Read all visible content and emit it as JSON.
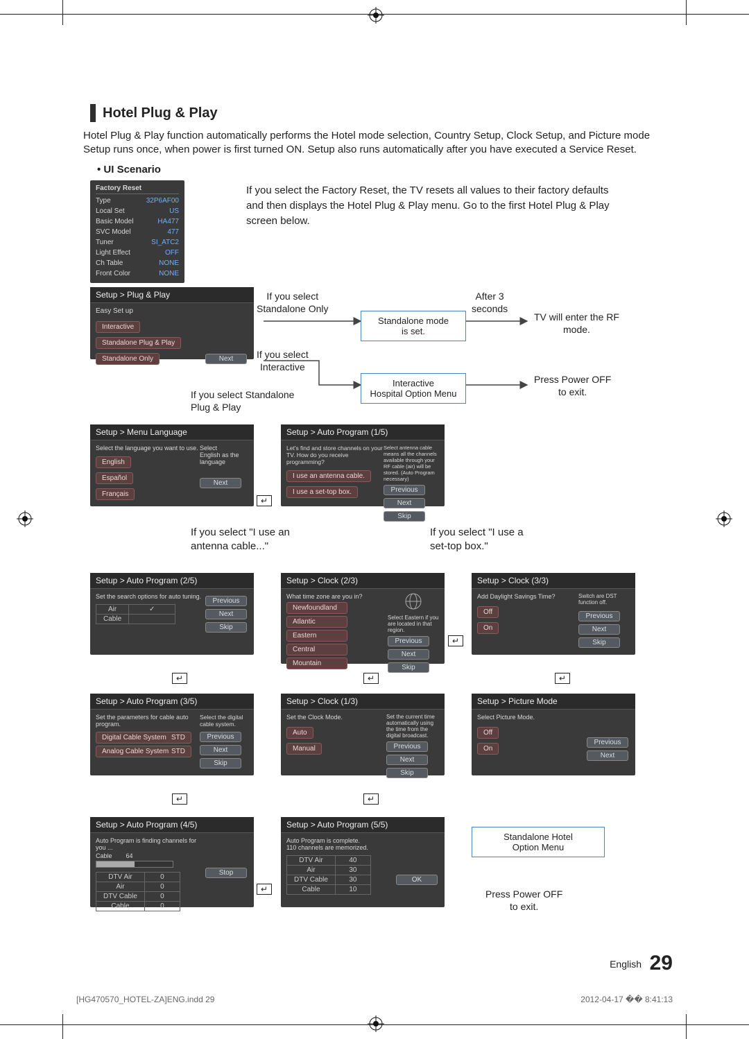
{
  "section_title": "Hotel Plug & Play",
  "intro": "Hotel Plug & Play function automatically performs the Hotel mode selection, Country Setup, Clock Setup, and Picture mode Setup runs once, when power is first turned ON. Setup also runs automatically after you have executed a Service Reset.",
  "bullet_ui": "UI Scenario",
  "factory_reset": {
    "title": "Factory Reset",
    "rows": [
      {
        "k": "Type",
        "v": "32P6AF00"
      },
      {
        "k": "Local Set",
        "v": "US"
      },
      {
        "k": "Basic Model",
        "v": "HA477"
      },
      {
        "k": "SVC Model",
        "v": "477"
      },
      {
        "k": "Tuner",
        "v": "SI_ATC2"
      },
      {
        "k": "Light Effect",
        "v": "OFF"
      },
      {
        "k": "Ch Table",
        "v": "NONE"
      },
      {
        "k": "Front Color",
        "v": "NONE"
      }
    ]
  },
  "text_top": "If you select the Factory Reset, the TV resets all values to their factory defaults and then displays the Hotel Plug & Play menu. Go to the first Hotel Plug & Play screen below.",
  "plug_play": {
    "hdr": "Setup > Plug & Play",
    "easy": "Easy Set up",
    "opts": [
      "Interactive",
      "Standalone Plug & Play",
      "Standalone Only"
    ],
    "next": "Next"
  },
  "lbl_standalone_only": "If you select\nStandalone Only",
  "lbl_interactive": "If you select\nInteractive",
  "lbl_standalone_pp": "If you select Standalone\nPlug & Play",
  "box_standalone_mode": "Standalone mode\nis set.",
  "lbl_after3": "After 3\nseconds",
  "lbl_rfmode": "TV will enter the RF\nmode.",
  "box_interactive_menu": "Interactive\nHospital Option Menu",
  "lbl_press_off": "Press Power OFF\nto exit.",
  "menu_lang": {
    "hdr": "Setup > Menu Language",
    "prompt": "Select the language you want to use.",
    "note": "Select\nEnglish as the\nlanguage",
    "opts": [
      "English",
      "Español",
      "Français"
    ],
    "next": "Next"
  },
  "auto1": {
    "hdr": "Setup > Auto Program (1/5)",
    "prompt": "Let's find and store channels on your TV. How do you receive programming?",
    "note": "Select antenna cable means all the channels available through your RF cable (air) will be stored. (Auto Program necessary)",
    "opt1": "I use an antenna cable.",
    "opt2": "I use a set-top box.",
    "prev": "Previous",
    "next": "Next",
    "skip": "Skip"
  },
  "lbl_antenna": "If you select \"I use an\nantenna cable...\"",
  "lbl_settop": "If you select \"I use a\nset-top box.\"",
  "auto2": {
    "hdr": "Setup > Auto Program (2/5)",
    "prompt": "Set the search options for auto tuning.",
    "rows": [
      {
        "a": "Air",
        "b": "✓"
      },
      {
        "a": "Cable",
        "b": ""
      }
    ],
    "prev": "Previous",
    "next": "Next",
    "skip": "Skip"
  },
  "clock2": {
    "hdr": "Setup > Clock (2/3)",
    "prompt": "What time zone are you in?",
    "note": "Select Eastern if you are located in that region.",
    "opts": [
      "Newfoundland",
      "Atlantic",
      "Eastern",
      "Central",
      "Mountain"
    ],
    "prev": "Previous",
    "next": "Next",
    "skip": "Skip"
  },
  "clock3": {
    "hdr": "Setup > Clock (3/3)",
    "prompt": "Add Daylight Savings Time?",
    "note": "Switch are DST function off.",
    "opts": [
      "Off",
      "On"
    ],
    "prev": "Previous",
    "next": "Next",
    "skip": "Skip"
  },
  "auto3": {
    "hdr": "Setup > Auto Program (3/5)",
    "prompt": "Set the parameters for cable auto program.",
    "note": "Select the digital cable system.",
    "rows": [
      {
        "a": "Digital Cable System",
        "b": "STD"
      },
      {
        "a": "Analog Cable System",
        "b": "STD"
      }
    ],
    "prev": "Previous",
    "next": "Next",
    "skip": "Skip"
  },
  "clock1": {
    "hdr": "Setup > Clock (1/3)",
    "prompt": "Set the Clock Mode.",
    "note": "Set the current time automatically using the time from the digital broadcast.",
    "opts": [
      "Auto",
      "Manual"
    ],
    "prev": "Previous",
    "next": "Next",
    "skip": "Skip"
  },
  "picture": {
    "hdr": "Setup > Picture Mode",
    "prompt": "Select Picture Mode.",
    "opts": [
      "Off",
      "On"
    ],
    "prev": "Previous",
    "next": "Next"
  },
  "auto4": {
    "hdr": "Setup > Auto Program (4/5)",
    "prompt": "Auto Program is finding channels for you ...",
    "cable": "Cable",
    "cableval": "64",
    "rows": [
      {
        "a": "DTV Air",
        "b": "0"
      },
      {
        "a": "Air",
        "b": "0"
      },
      {
        "a": "DTV Cable",
        "b": "0"
      },
      {
        "a": "Cable",
        "b": "0"
      }
    ],
    "stop": "Stop"
  },
  "auto5": {
    "hdr": "Setup > Auto Program (5/5)",
    "prompt": "Auto Program is complete.",
    "mem": "110 channels are memorized.",
    "rows": [
      {
        "a": "DTV Air",
        "b": "40"
      },
      {
        "a": "Air",
        "b": "30"
      },
      {
        "a": "DTV Cable",
        "b": "30"
      },
      {
        "a": "Cable",
        "b": "10"
      }
    ],
    "ok": "OK"
  },
  "box_standalone_hotel": "Standalone Hotel\nOption Menu",
  "lbl_press_off2": "Press Power OFF\nto exit.",
  "footer_l": "[HG470570_HOTEL-ZA]ENG.indd   29",
  "footer_r": "2012-04-17   �� 8:41:13",
  "lang": "English",
  "pagenum": "29"
}
